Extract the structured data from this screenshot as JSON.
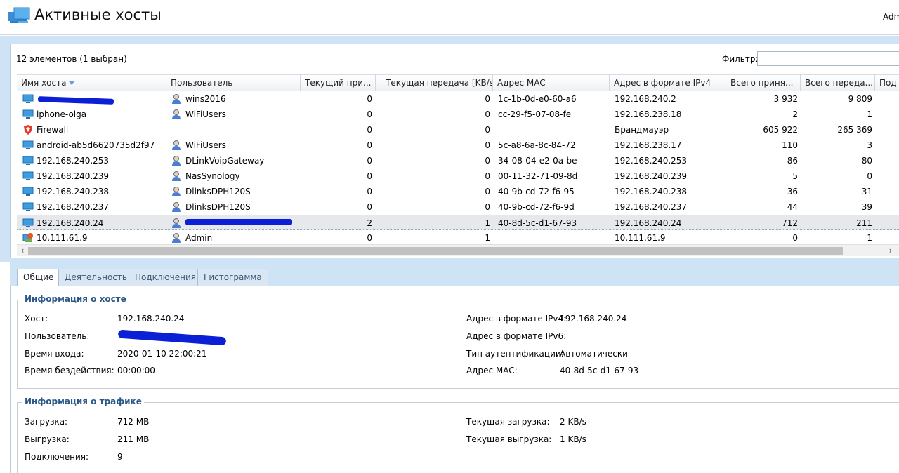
{
  "header": {
    "title": "Активные хосты",
    "user": "Admin"
  },
  "toolbar": {
    "count_label": "12 элементов (1 выбран)",
    "filter_label": "Фильтр:",
    "filter_value": ""
  },
  "grid": {
    "columns": [
      "Имя хоста",
      "Пользователь",
      "Текущий при...",
      "Текущая передача [KB/s]",
      "Адрес MAC",
      "Адрес в формате IPv4",
      "Всего приня...",
      "Всего переда...",
      "Под"
    ],
    "rows": [
      {
        "icon": "computer-icon",
        "host": "",
        "user_icon": "user-icon",
        "user": "wins2016",
        "rx": "0",
        "tx": "0",
        "mac": "1c-1b-0d-e0-60-a6",
        "ipv4": "192.168.240.2",
        "total_rx": "3 932",
        "total_tx": "9 809"
      },
      {
        "icon": "computer-icon",
        "host": "iphone-olga",
        "user_icon": "user-icon",
        "user": "WiFiUsers",
        "rx": "0",
        "tx": "0",
        "mac": "cc-29-f5-07-08-fe",
        "ipv4": "192.168.238.18",
        "total_rx": "2",
        "total_tx": "1"
      },
      {
        "icon": "firewall-shield-icon",
        "host": "Firewall",
        "user_icon": "",
        "user": "",
        "rx": "0",
        "tx": "0",
        "mac": "",
        "ipv4": "Брандмауэр",
        "total_rx": "605 922",
        "total_tx": "265 369"
      },
      {
        "icon": "computer-icon",
        "host": "android-ab5d6620735d2f97",
        "user_icon": "user-icon",
        "user": "WiFiUsers",
        "rx": "0",
        "tx": "0",
        "mac": "5c-a8-6a-8c-84-72",
        "ipv4": "192.168.238.17",
        "total_rx": "110",
        "total_tx": "3"
      },
      {
        "icon": "computer-icon",
        "host": "192.168.240.253",
        "user_icon": "user-icon",
        "user": "DLinkVoipGateway",
        "rx": "0",
        "tx": "0",
        "mac": "34-08-04-e2-0a-be",
        "ipv4": "192.168.240.253",
        "total_rx": "86",
        "total_tx": "80"
      },
      {
        "icon": "computer-icon",
        "host": "192.168.240.239",
        "user_icon": "user-icon",
        "user": "NasSynology",
        "rx": "0",
        "tx": "0",
        "mac": "00-11-32-71-09-8d",
        "ipv4": "192.168.240.239",
        "total_rx": "5",
        "total_tx": "0"
      },
      {
        "icon": "computer-icon",
        "host": "192.168.240.238",
        "user_icon": "user-icon",
        "user": "DlinksDPH120S",
        "rx": "0",
        "tx": "0",
        "mac": "40-9b-cd-72-f6-95",
        "ipv4": "192.168.240.238",
        "total_rx": "36",
        "total_tx": "31"
      },
      {
        "icon": "computer-icon",
        "host": "192.168.240.237",
        "user_icon": "user-icon",
        "user": "DlinksDPH120S",
        "rx": "0",
        "tx": "0",
        "mac": "40-9b-cd-72-f6-9d",
        "ipv4": "192.168.240.237",
        "total_rx": "44",
        "total_tx": "39"
      },
      {
        "icon": "computer-icon",
        "host": "192.168.240.24",
        "user_icon": "user-icon",
        "user": "",
        "rx": "2",
        "tx": "1",
        "mac": "40-8d-5c-d1-67-93",
        "ipv4": "192.168.240.24",
        "total_rx": "712",
        "total_tx": "211"
      },
      {
        "icon": "local-host-icon",
        "host": "10.111.61.9",
        "user_icon": "user-icon",
        "user": "Admin",
        "rx": "0",
        "tx": "1",
        "mac": "",
        "ipv4": "10.111.61.9",
        "total_rx": "0",
        "total_tx": "1"
      }
    ]
  },
  "tabs": [
    "Общие",
    "Деятельность",
    "Подключения",
    "Гистограмма"
  ],
  "host_info": {
    "title": "Информация о хосте",
    "host_label": "Хост:",
    "host_value": "192.168.240.24",
    "user_label": "Пользователь:",
    "user_value": "",
    "login_label": "Время входа:",
    "login_value": "2020-01-10 22:00:21",
    "idle_label": "Время бездействия:",
    "idle_value": "00:00:00",
    "ipv4_label": "Адрес в формате IPv4:",
    "ipv4_value": "192.168.240.24",
    "ipv6_label": "Адрес в формате IPv6:",
    "ipv6_value": "",
    "auth_label": "Тип аутентификации:",
    "auth_value": "Автоматически",
    "mac_label": "Адрес MAC:",
    "mac_value": "40-8d-5c-d1-67-93"
  },
  "traffic_info": {
    "title": "Информация о трафике",
    "download_label": "Загрузка:",
    "download_value": "712 MB",
    "upload_label": "Выгрузка:",
    "upload_value": "211 MB",
    "conn_label": "Подключения:",
    "conn_value": "9",
    "cur_download_label": "Текущая загрузка:",
    "cur_download_value": "2 KB/s",
    "cur_upload_label": "Текущая выгрузка:",
    "cur_upload_value": "1 KB/s"
  },
  "colors": {
    "accent": "#2b5886",
    "band": "#cfe3f7",
    "redaction": "#0a1fd6"
  }
}
